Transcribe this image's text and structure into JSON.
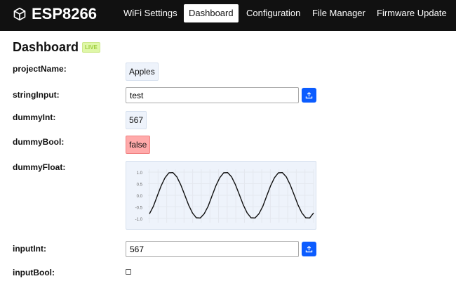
{
  "nav": {
    "brand": "ESP8266",
    "brand_icon": "cube-icon",
    "links": [
      "WiFi Settings",
      "Dashboard",
      "Configuration",
      "File Manager",
      "Firmware Update"
    ],
    "active": "Dashboard"
  },
  "page": {
    "title": "Dashboard",
    "badge": "LIVE"
  },
  "fields": {
    "projectName": {
      "label": "projectName:",
      "value": "Apples"
    },
    "stringInput": {
      "label": "stringInput:",
      "value": "test"
    },
    "dummyInt": {
      "label": "dummyInt:",
      "value": "567"
    },
    "dummyBool": {
      "label": "dummyBool:",
      "value": "false"
    },
    "dummyFloat": {
      "label": "dummyFloat:"
    },
    "inputInt": {
      "label": "inputInt:",
      "value": "567"
    },
    "inputBool": {
      "label": "inputBool:",
      "checked": false
    }
  },
  "colors": {
    "navbar": "#111111",
    "accent": "#0b5cff",
    "false_badge": "#ffaaaa",
    "live_badge": "#dff7a8"
  },
  "chart_data": {
    "type": "line",
    "yticks": [
      "1.0",
      "0.5",
      "0.0",
      "-0.5",
      "-1.0"
    ],
    "ylim": [
      -1.1,
      1.1
    ],
    "grid": true,
    "values": [
      -0.8,
      -0.48,
      -0.03,
      0.41,
      0.76,
      0.97,
      0.98,
      0.8,
      0.46,
      0.03,
      -0.41,
      -0.76,
      -0.97,
      -0.98,
      -0.8,
      -0.48,
      -0.03,
      0.41,
      0.76,
      0.97,
      0.98,
      0.8,
      0.46,
      0.03,
      -0.41,
      -0.76,
      -0.97,
      -0.98,
      -0.8,
      -0.48,
      -0.03,
      0.41,
      0.76,
      0.97,
      0.98,
      0.8,
      0.46,
      0.03,
      -0.41,
      -0.76,
      -0.97,
      -0.98,
      -0.76
    ]
  }
}
